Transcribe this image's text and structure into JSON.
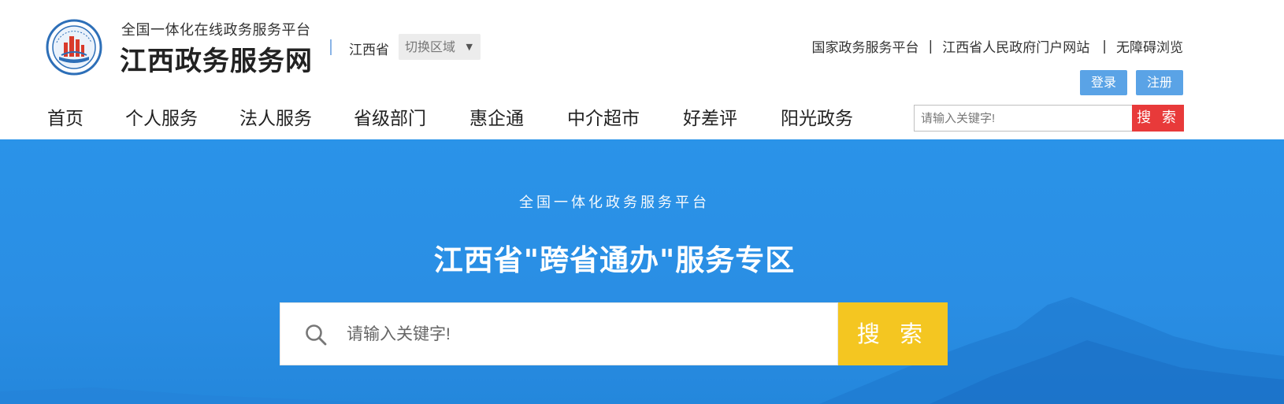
{
  "brand": {
    "subtitle": "全国一体化在线政务服务平台",
    "title": "江西政务服务网",
    "emblem_icon": "jiangxi-gov-emblem-icon"
  },
  "region": {
    "current": "江西省",
    "switch_label": "切换区域",
    "caret_icon": "▼"
  },
  "toplinks": {
    "items": [
      "国家政务服务平台",
      "江西省人民政府门户网站",
      "无障碍浏览"
    ],
    "separator": "|"
  },
  "auth": {
    "login_label": "登录",
    "register_label": "注册"
  },
  "nav": {
    "items": [
      "首页",
      "个人服务",
      "法人服务",
      "省级部门",
      "惠企通",
      "中介超市",
      "好差评",
      "阳光政务"
    ]
  },
  "top_search": {
    "placeholder": "请输入关键字!",
    "button_label": "搜 索",
    "button_color": "#e83a3a"
  },
  "banner": {
    "subtitle": "全国一体化政务服务平台",
    "title": "江西省\"跨省通办\"服务专区",
    "background_color": "#2a8ee4"
  },
  "main_search": {
    "placeholder": "请输入关键字!",
    "button_label": "搜 索",
    "button_color": "#f4c621",
    "icon": "search-icon"
  },
  "colors": {
    "accent_blue": "#5aa3e6",
    "banner_blue": "#2a8ee4",
    "red": "#e83a3a",
    "yellow": "#f4c621"
  }
}
